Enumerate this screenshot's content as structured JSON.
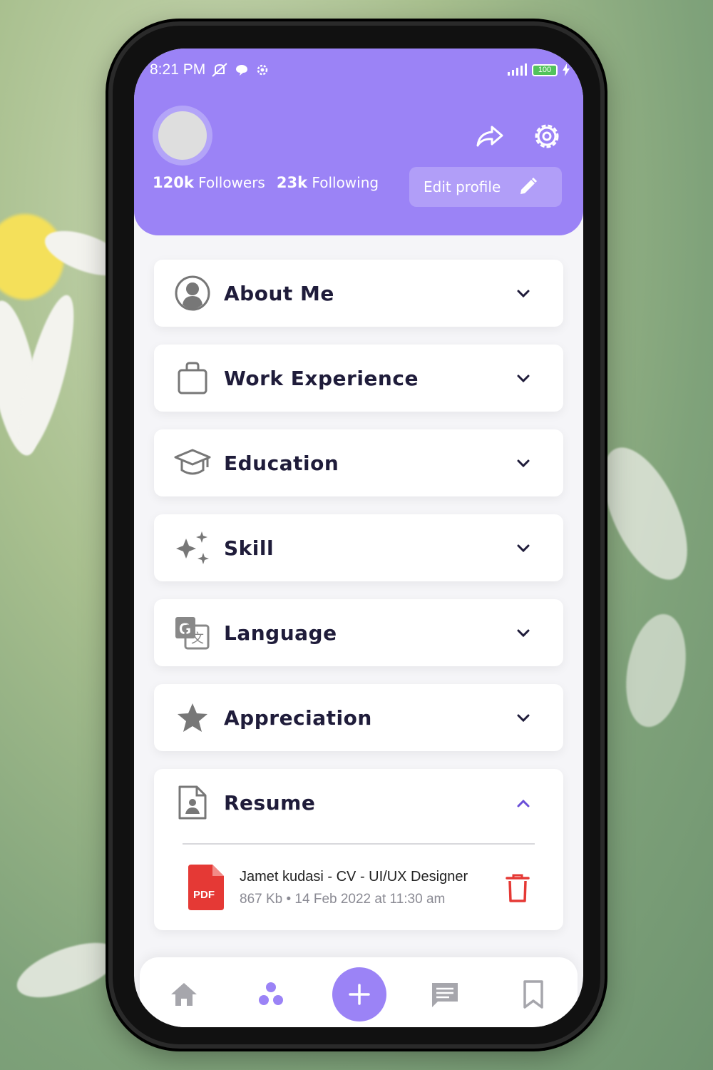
{
  "status_bar": {
    "time": "8:21 PM",
    "battery": "100"
  },
  "profile": {
    "followers_count": "120k",
    "followers_label": "Followers",
    "following_count": "23k",
    "following_label": "Following",
    "edit_label": "Edit profile"
  },
  "sections": [
    {
      "label": "About Me",
      "icon": "person-icon"
    },
    {
      "label": "Work Experience",
      "icon": "briefcase-icon"
    },
    {
      "label": "Education",
      "icon": "graduation-cap-icon"
    },
    {
      "label": "Skill",
      "icon": "sparkle-icon"
    },
    {
      "label": "Language",
      "icon": "translate-icon"
    },
    {
      "label": "Appreciation",
      "icon": "star-icon"
    }
  ],
  "resume": {
    "label": "Resume",
    "file": {
      "badge": "PDF",
      "name": "Jamet kudasi - CV - UI/UX Designer",
      "meta": "867 Kb • 14 Feb 2022 at 11:30 am"
    }
  },
  "colors": {
    "accent": "#9b83f6",
    "text": "#1f1c3a",
    "danger": "#e53935"
  }
}
